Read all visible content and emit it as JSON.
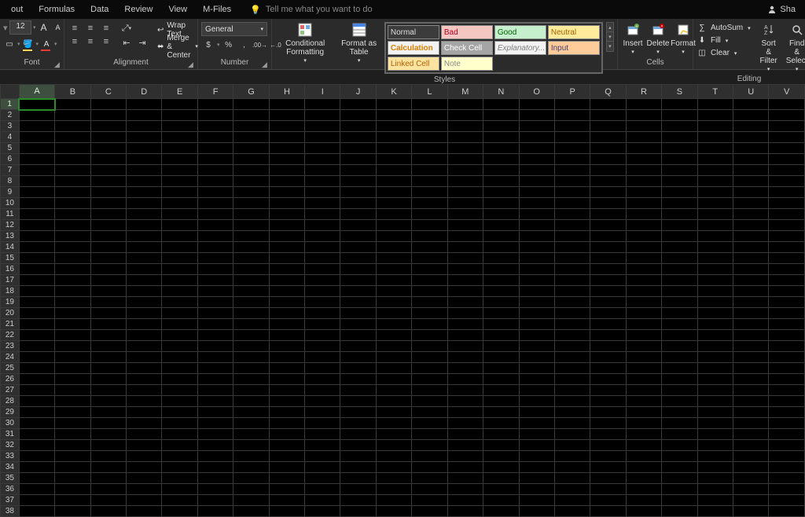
{
  "menu": {
    "items": [
      "out",
      "Formulas",
      "Data",
      "Review",
      "View",
      "M-Files"
    ],
    "tellme": "Tell me what you want to do",
    "share": "Sha"
  },
  "ribbon": {
    "font": {
      "size": "12",
      "label": "Font"
    },
    "alignment": {
      "wrap": "Wrap Text",
      "merge": "Merge & Center",
      "label": "Alignment"
    },
    "number": {
      "format": "General",
      "label": "Number"
    },
    "styles": {
      "cond": "Conditional Formatting",
      "table": "Format as Table",
      "cells": [
        "Normal",
        "Bad",
        "Good",
        "Neutral",
        "Calculation",
        "Check Cell",
        "Explanatory...",
        "Input",
        "Linked Cell",
        "Note"
      ],
      "label": "Styles"
    },
    "cells": {
      "insert": "Insert",
      "delete": "Delete",
      "format": "Format",
      "label": "Cells"
    },
    "editing": {
      "autosum": "AutoSum",
      "fill": "Fill",
      "clear": "Clear",
      "sort": "Sort & Filter",
      "find": "Find & Select",
      "label": "Editing"
    }
  },
  "sheet": {
    "columns": [
      "A",
      "B",
      "C",
      "D",
      "E",
      "F",
      "G",
      "H",
      "I",
      "J",
      "K",
      "L",
      "M",
      "N",
      "O",
      "P",
      "Q",
      "R",
      "S",
      "T",
      "U",
      "V"
    ],
    "rows": 38,
    "selectedCol": "A",
    "selectedRow": 1
  }
}
